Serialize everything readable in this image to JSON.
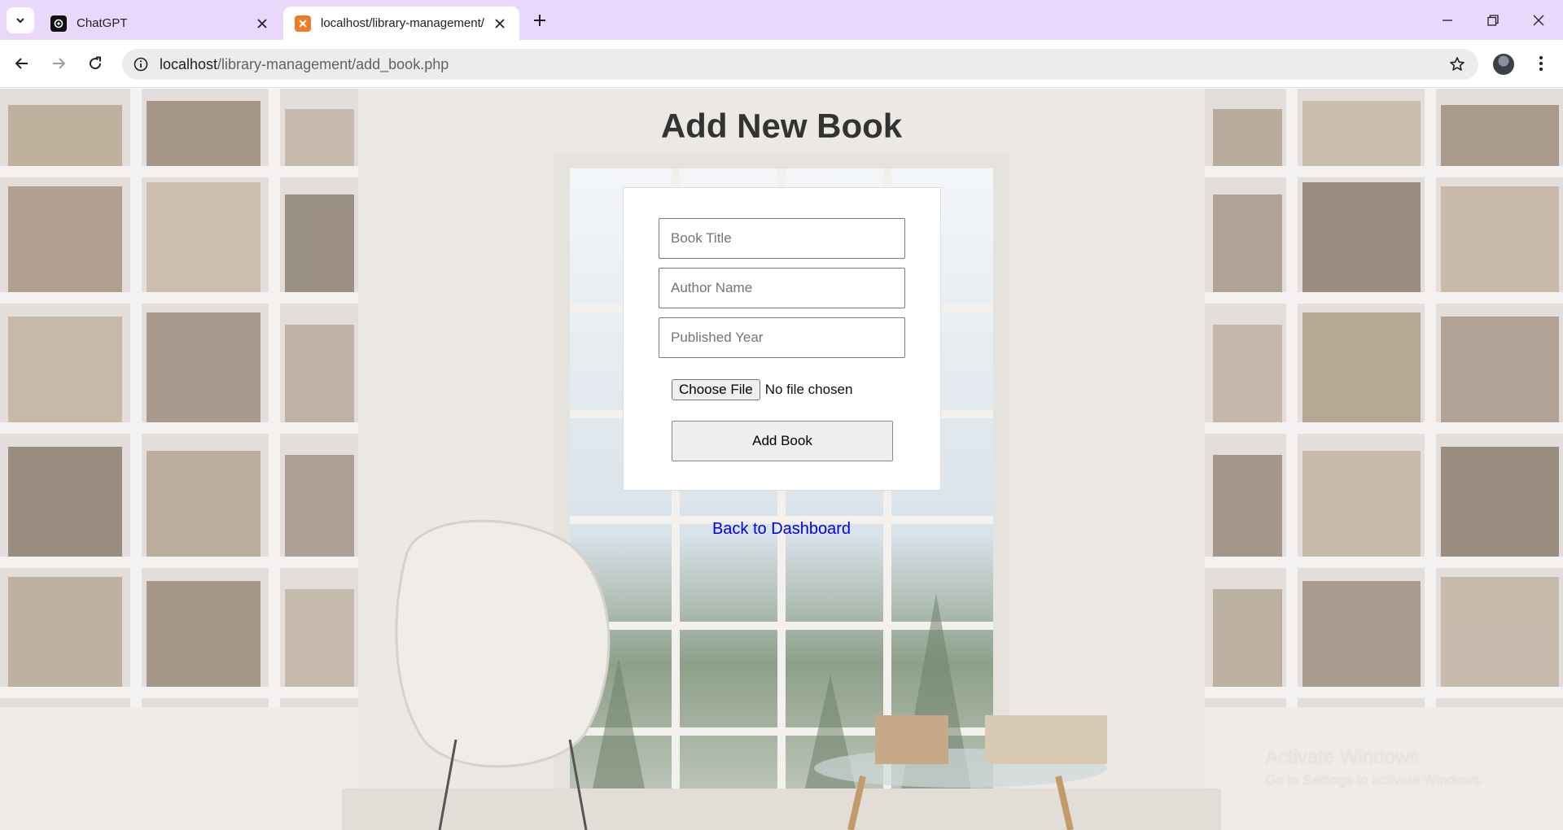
{
  "browser": {
    "tabs": [
      {
        "title": "ChatGPT",
        "active": false,
        "favicon": "chatgpt-icon"
      },
      {
        "title": "localhost/library-management/",
        "active": true,
        "favicon": "xampp-icon"
      }
    ],
    "url_host": "localhost",
    "url_path": "/library-management/add_book.php"
  },
  "page": {
    "title": "Add New Book",
    "form": {
      "book_title_placeholder": "Book Title",
      "book_title_value": "",
      "author_placeholder": "Author Name",
      "author_value": "",
      "year_placeholder": "Published Year",
      "year_value": "",
      "file_button_label": "Choose File",
      "file_status": "No file chosen",
      "submit_label": "Add Book"
    },
    "back_link": "Back to Dashboard"
  },
  "watermark": {
    "title": "Activate Windows",
    "subtitle": "Go to Settings to activate Windows."
  },
  "colors": {
    "tabstrip": "#e9d8fb",
    "link": "#0000ee",
    "title_text": "#333333"
  }
}
